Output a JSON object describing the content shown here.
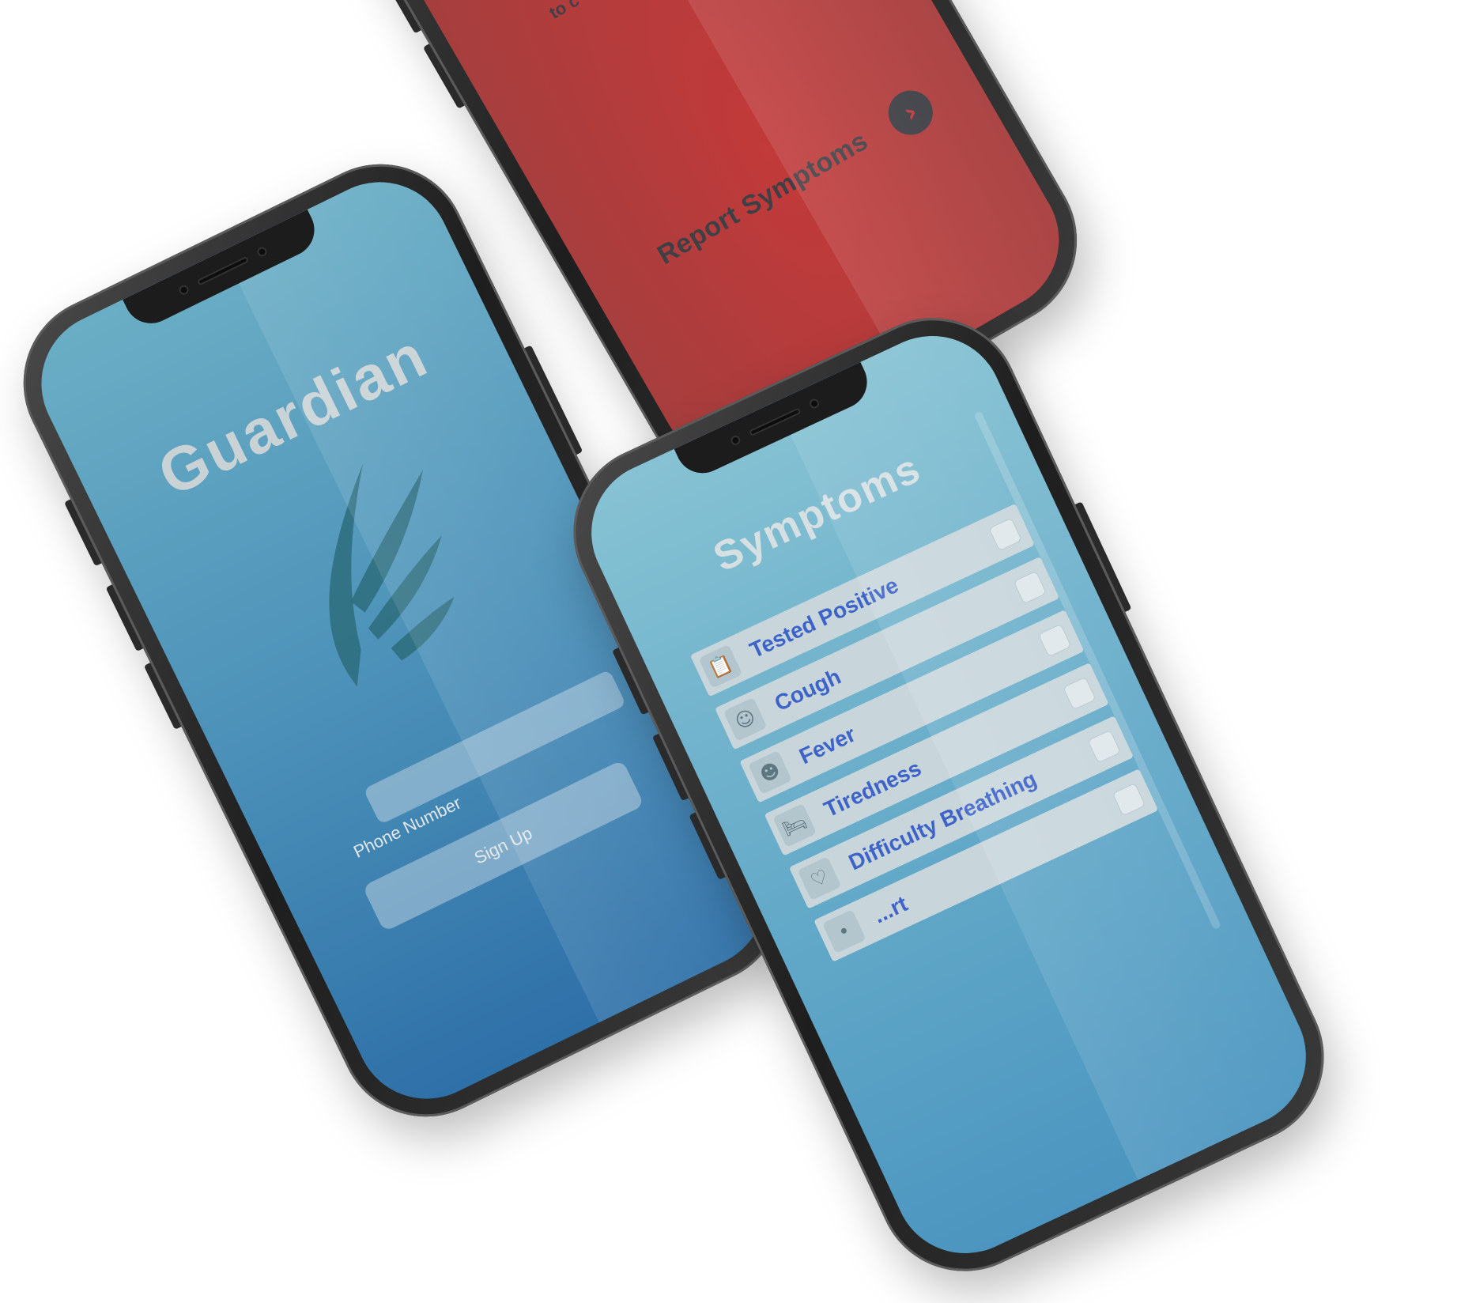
{
  "red_screen": {
    "partial_text": "to c",
    "report_label": "Report Symptoms",
    "arrow_glyph": "›",
    "background": "#b83c3c"
  },
  "login_screen": {
    "title": "Guardian",
    "phone_label": "Phone Number",
    "signup_label": "Sign Up",
    "background": "#4a8fb8"
  },
  "symptoms_screen": {
    "title": "Symptoms",
    "items": [
      {
        "label": "Tested Positive",
        "icon": "clipboard-icon",
        "glyph": "📋"
      },
      {
        "label": "Cough",
        "icon": "cough-icon",
        "glyph": "☺"
      },
      {
        "label": "Fever",
        "icon": "thermometer-icon",
        "glyph": "☻"
      },
      {
        "label": "Tiredness",
        "icon": "bed-icon",
        "glyph": "🛏"
      },
      {
        "label": "Difficulty Breathing",
        "icon": "lungs-icon",
        "glyph": "♡"
      },
      {
        "label": "...rt",
        "icon": "misc-icon",
        "glyph": "•"
      }
    ],
    "label_color": "#3d63c8"
  }
}
